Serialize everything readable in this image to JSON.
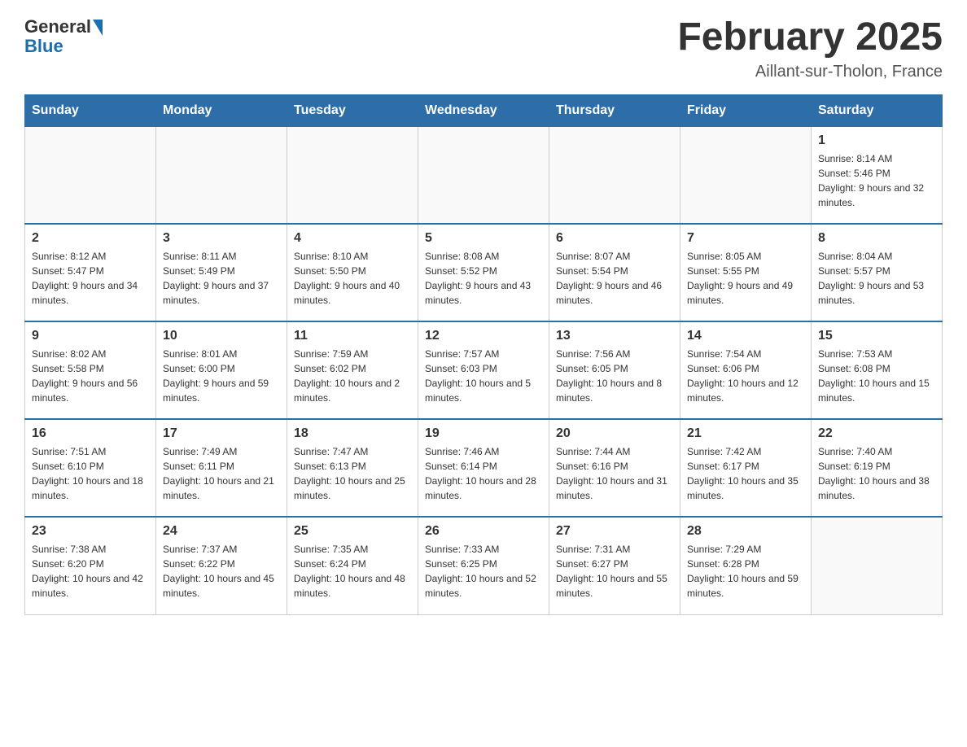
{
  "header": {
    "logo": {
      "general": "General",
      "blue": "Blue"
    },
    "title": "February 2025",
    "location": "Aillant-sur-Tholon, France"
  },
  "days_of_week": [
    "Sunday",
    "Monday",
    "Tuesday",
    "Wednesday",
    "Thursday",
    "Friday",
    "Saturday"
  ],
  "weeks": [
    [
      {
        "day": "",
        "info": ""
      },
      {
        "day": "",
        "info": ""
      },
      {
        "day": "",
        "info": ""
      },
      {
        "day": "",
        "info": ""
      },
      {
        "day": "",
        "info": ""
      },
      {
        "day": "",
        "info": ""
      },
      {
        "day": "1",
        "info": "Sunrise: 8:14 AM\nSunset: 5:46 PM\nDaylight: 9 hours and 32 minutes."
      }
    ],
    [
      {
        "day": "2",
        "info": "Sunrise: 8:12 AM\nSunset: 5:47 PM\nDaylight: 9 hours and 34 minutes."
      },
      {
        "day": "3",
        "info": "Sunrise: 8:11 AM\nSunset: 5:49 PM\nDaylight: 9 hours and 37 minutes."
      },
      {
        "day": "4",
        "info": "Sunrise: 8:10 AM\nSunset: 5:50 PM\nDaylight: 9 hours and 40 minutes."
      },
      {
        "day": "5",
        "info": "Sunrise: 8:08 AM\nSunset: 5:52 PM\nDaylight: 9 hours and 43 minutes."
      },
      {
        "day": "6",
        "info": "Sunrise: 8:07 AM\nSunset: 5:54 PM\nDaylight: 9 hours and 46 minutes."
      },
      {
        "day": "7",
        "info": "Sunrise: 8:05 AM\nSunset: 5:55 PM\nDaylight: 9 hours and 49 minutes."
      },
      {
        "day": "8",
        "info": "Sunrise: 8:04 AM\nSunset: 5:57 PM\nDaylight: 9 hours and 53 minutes."
      }
    ],
    [
      {
        "day": "9",
        "info": "Sunrise: 8:02 AM\nSunset: 5:58 PM\nDaylight: 9 hours and 56 minutes."
      },
      {
        "day": "10",
        "info": "Sunrise: 8:01 AM\nSunset: 6:00 PM\nDaylight: 9 hours and 59 minutes."
      },
      {
        "day": "11",
        "info": "Sunrise: 7:59 AM\nSunset: 6:02 PM\nDaylight: 10 hours and 2 minutes."
      },
      {
        "day": "12",
        "info": "Sunrise: 7:57 AM\nSunset: 6:03 PM\nDaylight: 10 hours and 5 minutes."
      },
      {
        "day": "13",
        "info": "Sunrise: 7:56 AM\nSunset: 6:05 PM\nDaylight: 10 hours and 8 minutes."
      },
      {
        "day": "14",
        "info": "Sunrise: 7:54 AM\nSunset: 6:06 PM\nDaylight: 10 hours and 12 minutes."
      },
      {
        "day": "15",
        "info": "Sunrise: 7:53 AM\nSunset: 6:08 PM\nDaylight: 10 hours and 15 minutes."
      }
    ],
    [
      {
        "day": "16",
        "info": "Sunrise: 7:51 AM\nSunset: 6:10 PM\nDaylight: 10 hours and 18 minutes."
      },
      {
        "day": "17",
        "info": "Sunrise: 7:49 AM\nSunset: 6:11 PM\nDaylight: 10 hours and 21 minutes."
      },
      {
        "day": "18",
        "info": "Sunrise: 7:47 AM\nSunset: 6:13 PM\nDaylight: 10 hours and 25 minutes."
      },
      {
        "day": "19",
        "info": "Sunrise: 7:46 AM\nSunset: 6:14 PM\nDaylight: 10 hours and 28 minutes."
      },
      {
        "day": "20",
        "info": "Sunrise: 7:44 AM\nSunset: 6:16 PM\nDaylight: 10 hours and 31 minutes."
      },
      {
        "day": "21",
        "info": "Sunrise: 7:42 AM\nSunset: 6:17 PM\nDaylight: 10 hours and 35 minutes."
      },
      {
        "day": "22",
        "info": "Sunrise: 7:40 AM\nSunset: 6:19 PM\nDaylight: 10 hours and 38 minutes."
      }
    ],
    [
      {
        "day": "23",
        "info": "Sunrise: 7:38 AM\nSunset: 6:20 PM\nDaylight: 10 hours and 42 minutes."
      },
      {
        "day": "24",
        "info": "Sunrise: 7:37 AM\nSunset: 6:22 PM\nDaylight: 10 hours and 45 minutes."
      },
      {
        "day": "25",
        "info": "Sunrise: 7:35 AM\nSunset: 6:24 PM\nDaylight: 10 hours and 48 minutes."
      },
      {
        "day": "26",
        "info": "Sunrise: 7:33 AM\nSunset: 6:25 PM\nDaylight: 10 hours and 52 minutes."
      },
      {
        "day": "27",
        "info": "Sunrise: 7:31 AM\nSunset: 6:27 PM\nDaylight: 10 hours and 55 minutes."
      },
      {
        "day": "28",
        "info": "Sunrise: 7:29 AM\nSunset: 6:28 PM\nDaylight: 10 hours and 59 minutes."
      },
      {
        "day": "",
        "info": ""
      }
    ]
  ]
}
